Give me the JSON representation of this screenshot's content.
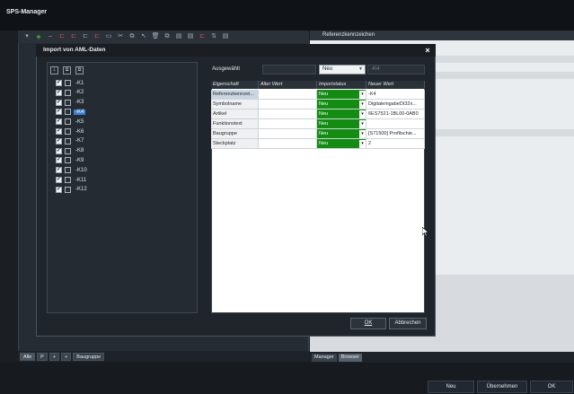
{
  "app": {
    "title": "SPS-Manager"
  },
  "toolbar": {
    "icons": [
      "plus-icon",
      "minus-icon",
      "insert-icon",
      "insert-icon",
      "insert-icon",
      "insert-icon",
      "cut-icon",
      "copy-icon",
      "cursor-icon",
      "delete-icon",
      "copy-icon",
      "grid-icon",
      "grid-icon",
      "insert-icon",
      "sort-icon",
      "grid-icon"
    ]
  },
  "right_pane": {
    "tab_label": "Referenzkennzeichen"
  },
  "dialog": {
    "title": "Import von AML-Daten",
    "close": "×",
    "tree_items": [
      "-K1",
      "-K2",
      "-K3",
      "-K4",
      "-K5",
      "-K6",
      "-K7",
      "-K8",
      "-K9",
      "-K10",
      "-K11",
      "-K12"
    ],
    "selected_tree_item": "-K4",
    "selection": {
      "label": "Ausgewählt",
      "dropdown_value": "Neu",
      "new_value": "-K4"
    },
    "grid": {
      "headers": [
        "Eigenschaft",
        "Alter Wert",
        "Importstatus",
        "Neuer Wert"
      ],
      "rows": [
        [
          "Referenzkennzei...",
          "",
          "Neu",
          "-K4"
        ],
        [
          "Symbolname",
          "",
          "Neu",
          "DigitaleingabeDI32x..."
        ],
        [
          "Artikel",
          "",
          "Neu",
          "6ES7521-1BL00-0AB0"
        ],
        [
          "Funktionstext",
          "",
          "Neu",
          ""
        ],
        [
          "Baugruppe",
          "",
          "Neu",
          "[S71500] Profilschie..."
        ],
        [
          "Steckplatz",
          "",
          "Neu",
          "2"
        ]
      ]
    },
    "ok_label": "OK",
    "cancel_label": "Abbrechen"
  },
  "left_tabs": [
    "Alle",
    "P",
    "+",
    "+",
    "Baugruppe"
  ],
  "right_tabs": [
    "Manager",
    "Browser"
  ],
  "bottom_buttons": [
    "Neu",
    "Übernehmen",
    "OK"
  ],
  "colors": {
    "status_green": "#128d12",
    "selection_blue": "#3b7fd4"
  }
}
